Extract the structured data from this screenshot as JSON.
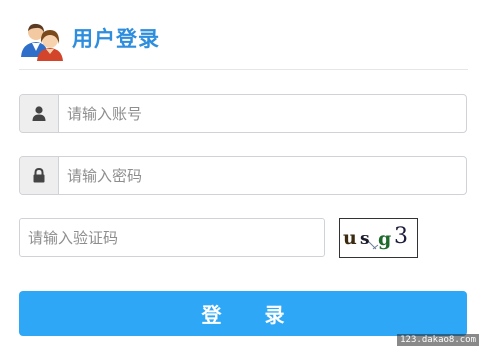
{
  "header": {
    "title": "用户登录",
    "logo_icon": "users-icon"
  },
  "form": {
    "account": {
      "icon": "user-icon",
      "placeholder": "请输入账号",
      "value": ""
    },
    "password": {
      "icon": "lock-icon",
      "placeholder": "请输入密码",
      "value": ""
    },
    "captcha": {
      "placeholder": "请输入验证码",
      "value": "",
      "image_chars": [
        "u",
        "s",
        "g",
        "3"
      ]
    },
    "login_label": "登 录"
  },
  "colors": {
    "title": "#2e8ede",
    "button": "#2ea7f7",
    "border": "#cfd3d7",
    "addon": "#eeeeee"
  },
  "watermark": "123.dakao8.com"
}
